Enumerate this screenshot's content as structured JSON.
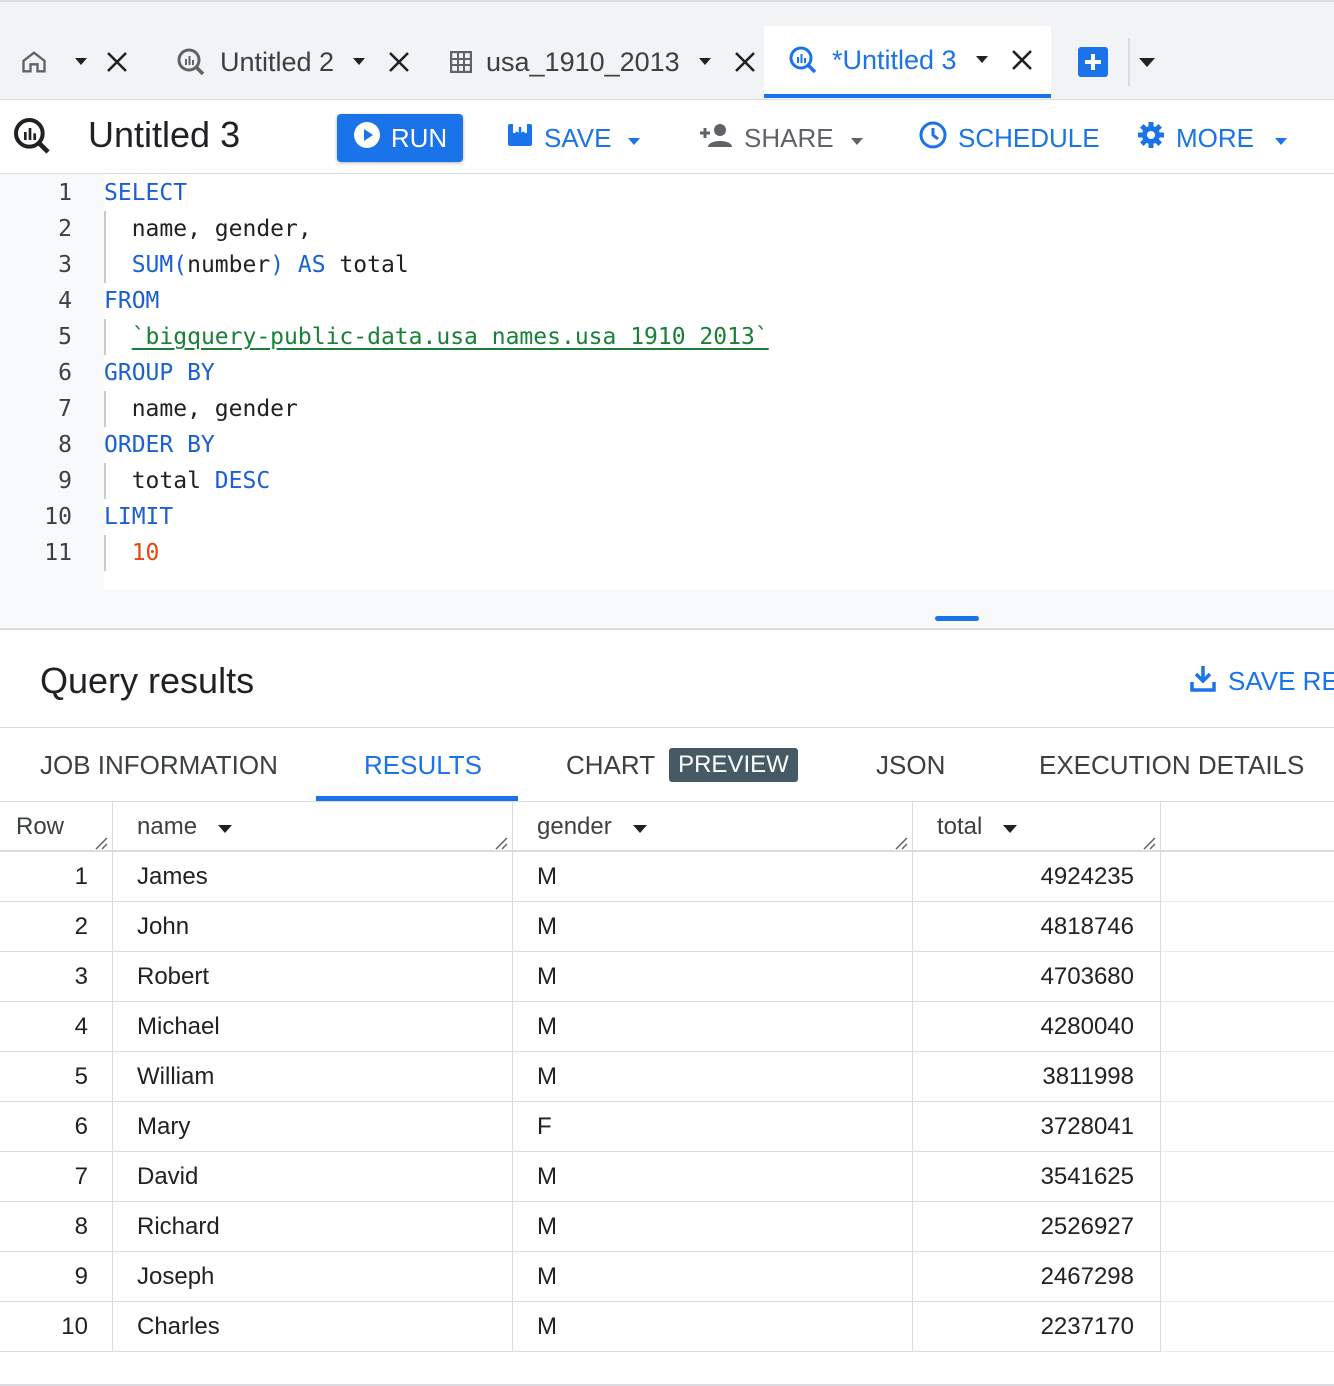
{
  "tabs": [
    {
      "id": "home",
      "label": ""
    },
    {
      "id": "untitled2",
      "label": "Untitled 2"
    },
    {
      "id": "table",
      "label": "usa_1910_2013"
    },
    {
      "id": "untitled3",
      "label": "*Untitled 3"
    }
  ],
  "toolbar": {
    "query_title": "Untitled 3",
    "run_label": "RUN",
    "save_label": "SAVE",
    "share_label": "SHARE",
    "schedule_label": "SCHEDULE",
    "more_label": "MORE"
  },
  "editor": {
    "lines": [
      {
        "n": "1",
        "parts": [
          {
            "t": "SELECT",
            "c": "kw"
          }
        ]
      },
      {
        "n": "2",
        "parts": [
          {
            "t": "  name, gender,",
            "c": ""
          }
        ]
      },
      {
        "n": "3",
        "parts": [
          {
            "t": "  ",
            "c": ""
          },
          {
            "t": "SUM(",
            "c": "kw"
          },
          {
            "t": "number",
            "c": ""
          },
          {
            "t": ")",
            "c": "kw"
          },
          {
            "t": " AS ",
            "c": "kw"
          },
          {
            "t": "total",
            "c": ""
          }
        ]
      },
      {
        "n": "4",
        "parts": [
          {
            "t": "FROM",
            "c": "kw"
          }
        ]
      },
      {
        "n": "5",
        "parts": [
          {
            "t": "  ",
            "c": ""
          },
          {
            "t": "`bigquery-public-data.usa_names.usa_1910_2013`",
            "c": "str"
          }
        ]
      },
      {
        "n": "6",
        "parts": [
          {
            "t": "GROUP BY",
            "c": "kw"
          }
        ]
      },
      {
        "n": "7",
        "parts": [
          {
            "t": "  name, gender",
            "c": ""
          }
        ]
      },
      {
        "n": "8",
        "parts": [
          {
            "t": "ORDER BY",
            "c": "kw"
          }
        ]
      },
      {
        "n": "9",
        "parts": [
          {
            "t": "  total ",
            "c": ""
          },
          {
            "t": "DESC",
            "c": "kw"
          }
        ]
      },
      {
        "n": "10",
        "parts": [
          {
            "t": "LIMIT",
            "c": "kw"
          }
        ]
      },
      {
        "n": "11",
        "parts": [
          {
            "t": "  ",
            "c": ""
          },
          {
            "t": "10",
            "c": "num"
          }
        ]
      }
    ]
  },
  "results": {
    "title": "Query results",
    "save_results_label": "SAVE RES",
    "tabs": {
      "job_info": "JOB INFORMATION",
      "results": "RESULTS",
      "chart": "CHART",
      "preview": "PREVIEW",
      "json": "JSON",
      "execution": "EXECUTION DETAILS"
    },
    "columns": {
      "row": "Row",
      "name": "name",
      "gender": "gender",
      "total": "total"
    },
    "rows": [
      {
        "row": "1",
        "name": "James",
        "gender": "M",
        "total": "4924235"
      },
      {
        "row": "2",
        "name": "John",
        "gender": "M",
        "total": "4818746"
      },
      {
        "row": "3",
        "name": "Robert",
        "gender": "M",
        "total": "4703680"
      },
      {
        "row": "4",
        "name": "Michael",
        "gender": "M",
        "total": "4280040"
      },
      {
        "row": "5",
        "name": "William",
        "gender": "M",
        "total": "3811998"
      },
      {
        "row": "6",
        "name": "Mary",
        "gender": "F",
        "total": "3728041"
      },
      {
        "row": "7",
        "name": "David",
        "gender": "M",
        "total": "3541625"
      },
      {
        "row": "8",
        "name": "Richard",
        "gender": "M",
        "total": "2526927"
      },
      {
        "row": "9",
        "name": "Joseph",
        "gender": "M",
        "total": "2467298"
      },
      {
        "row": "10",
        "name": "Charles",
        "gender": "M",
        "total": "2237170"
      }
    ]
  },
  "colors": {
    "accent": "#1a73e8",
    "keyword": "#1a5fd6",
    "string": "#188038",
    "number": "#e8440b",
    "badge": "#455a64"
  },
  "icons": [
    "home-icon",
    "query-icon",
    "table-icon",
    "close-icon",
    "dropdown-icon",
    "add-tab-icon",
    "play-icon",
    "save-icon",
    "share-icon",
    "schedule-icon",
    "gear-icon",
    "download-icon",
    "sort-icon",
    "resize-handle-icon"
  ]
}
